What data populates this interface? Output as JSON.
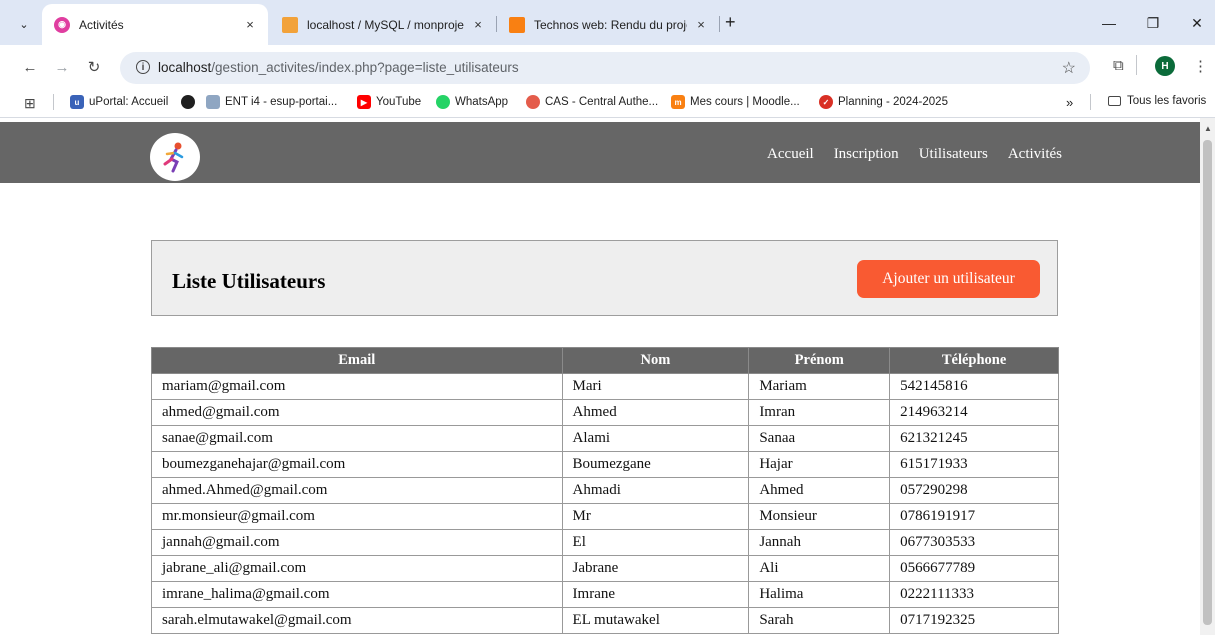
{
  "browser": {
    "tabs": [
      {
        "title": "Activités",
        "active": true,
        "favicon": "site-icon",
        "close": "×"
      },
      {
        "title": "localhost / MySQL / monprojet",
        "active": false,
        "favicon": "phpmyadmin-icon",
        "close": "×"
      },
      {
        "title": "Technos web: Rendu du projet",
        "active": false,
        "favicon": "moodle-icon",
        "close": "×"
      }
    ],
    "new_tab": "+",
    "window_controls": {
      "minimize": "—",
      "restore": "❐",
      "close": "✕"
    },
    "address": {
      "host": "localhost",
      "path": "/gestion_activites/index.php?page=liste_utilisateurs"
    },
    "profile_initial": "H",
    "bookmarks": [
      {
        "label": "uPortal: Accueil",
        "icon": "uportal-icon"
      },
      {
        "label": "",
        "icon": "github-icon"
      },
      {
        "label": "ENT i4 - esup-portai...",
        "icon": "ent-icon"
      },
      {
        "label": "YouTube",
        "icon": "youtube-icon"
      },
      {
        "label": "WhatsApp",
        "icon": "whatsapp-icon"
      },
      {
        "label": "CAS - Central Authe...",
        "icon": "cas-icon"
      },
      {
        "label": "Mes cours | Moodle...",
        "icon": "moodle-icon"
      },
      {
        "label": "Planning - 2024-2025",
        "icon": "planning-icon"
      }
    ],
    "bookmarks_overflow": "»",
    "all_bookmarks": "Tous les favoris"
  },
  "site": {
    "nav": [
      "Accueil",
      "Inscription",
      "Utilisateurs",
      "Activités"
    ],
    "panel_title": "Liste Utilisateurs",
    "add_button": "Ajouter un utilisateur"
  },
  "table": {
    "headers": [
      "Email",
      "Nom",
      "Prénom",
      "Téléphone"
    ],
    "rows": [
      [
        "mariam@gmail.com",
        "Mari",
        "Mariam",
        "542145816"
      ],
      [
        "ahmed@gmail.com",
        "Ahmed",
        "Imran",
        "214963214"
      ],
      [
        "sanae@gmail.com",
        "Alami",
        "Sanaa",
        "621321245"
      ],
      [
        "boumezganehajar@gmail.com",
        "Boumezgane",
        "Hajar",
        "615171933"
      ],
      [
        "ahmed.Ahmed@gmail.com",
        "Ahmadi",
        "Ahmed",
        "057290298"
      ],
      [
        "mr.monsieur@gmail.com",
        "Mr",
        "Monsieur",
        "0786191917"
      ],
      [
        "jannah@gmail.com",
        "El",
        "Jannah",
        "0677303533"
      ],
      [
        "jabrane_ali@gmail.com",
        "Jabrane",
        "Ali",
        "0566677789"
      ],
      [
        "imrane_halima@gmail.com",
        "Imrane",
        "Halima",
        "0222111333"
      ],
      [
        "sarah.elmutawakel@gmail.com",
        "EL mutawakel",
        "Sarah",
        "0717192325"
      ]
    ]
  },
  "colors": {
    "header_bg": "#666666",
    "accent_button": "#f95a32",
    "panel_bg": "#eeeeee"
  }
}
